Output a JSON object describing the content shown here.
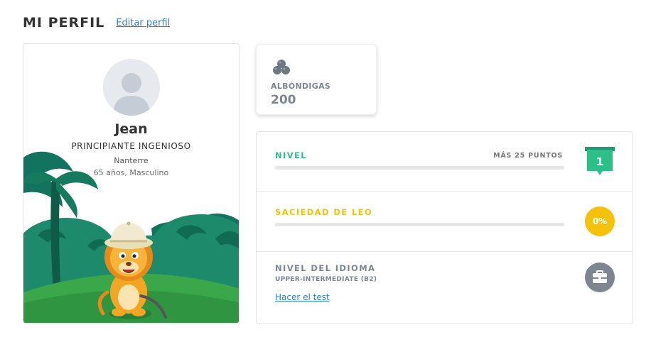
{
  "header": {
    "title": "MI PERFIL",
    "edit_link": "Editar perfil"
  },
  "profile": {
    "name": "Jean",
    "rank": "PRINCIPIANTE INGENIOSO",
    "city": "Nanterre",
    "details": "65 años, Masculino",
    "avatar_icon": "user-silhouette-icon",
    "illustration": "lion-explorer-jungle"
  },
  "meatballs": {
    "icon": "meatballs-icon",
    "label": "ALBÓNDIGAS",
    "value": "200"
  },
  "stats": {
    "level": {
      "title": "NIVEL",
      "note": "MÁS 25 PUNTOS",
      "value": "1",
      "progress": 0,
      "color": "#2bbf8a"
    },
    "satiety": {
      "title": "SACIEDAD DE LEO",
      "value": "0%",
      "progress": 0,
      "color": "#f5c20b"
    },
    "language": {
      "title": "NIVEL DEL IDIOMA",
      "level": "UPPER-INTERMEDIATE (B2)",
      "link": "Hacer el test",
      "icon": "briefcase-icon"
    }
  }
}
